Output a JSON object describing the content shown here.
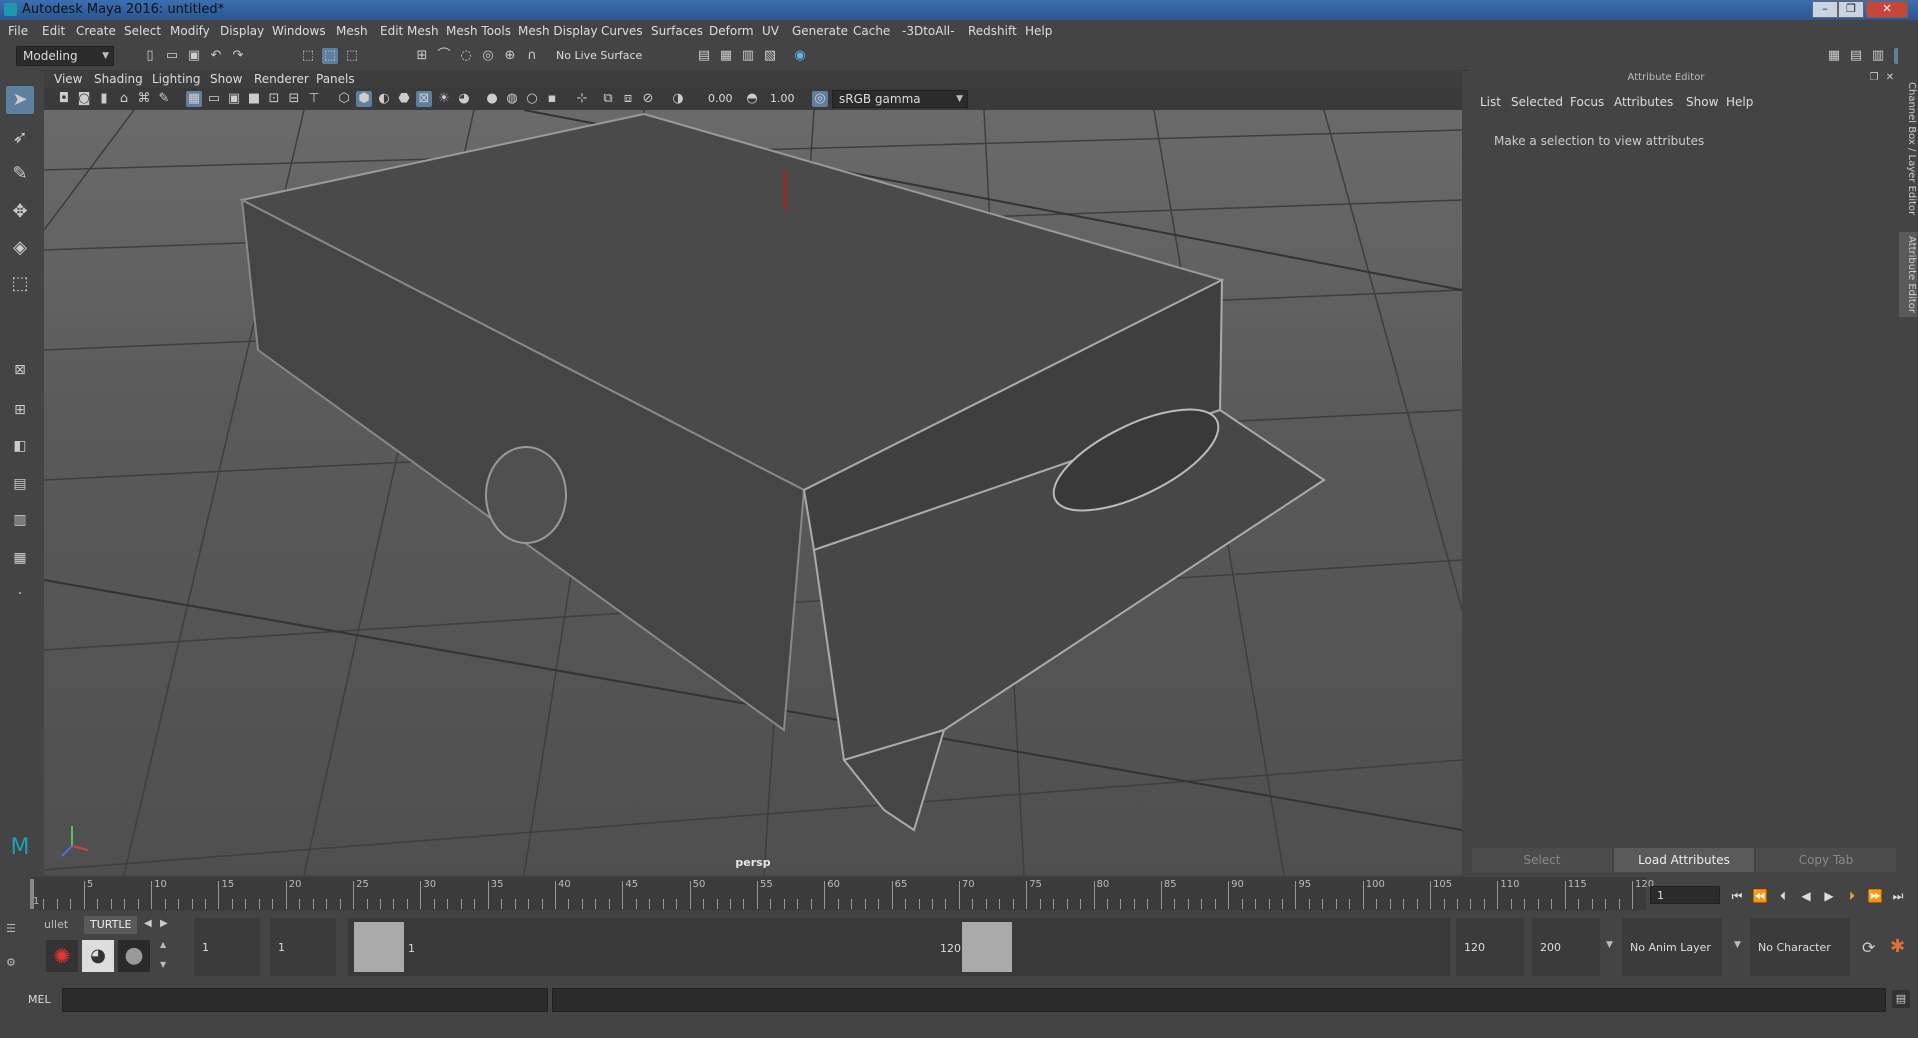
{
  "window": {
    "title": "Autodesk Maya 2016: untitled*"
  },
  "menubar": [
    "File",
    "Edit",
    "Create",
    "Select",
    "Modify",
    "Display",
    "Windows",
    "Mesh",
    "Edit Mesh",
    "Mesh Tools",
    "Mesh Display",
    "Curves",
    "Surfaces",
    "Deform",
    "UV",
    "Generate",
    "Cache",
    "-3DtoAll-",
    "Redshift",
    "Help"
  ],
  "toolbar": {
    "mode": "Modeling",
    "live_surface": "No Live Surface"
  },
  "viewport": {
    "menu": [
      "View",
      "Shading",
      "Lighting",
      "Show",
      "Renderer",
      "Panels"
    ],
    "exposure": "0.00",
    "gamma": "1.00",
    "color_space": "sRGB gamma",
    "camera_label": "persp"
  },
  "attribute_editor": {
    "title": "Attribute Editor",
    "menu": [
      "List",
      "Selected",
      "Focus",
      "Attributes",
      "Show",
      "Help"
    ],
    "message": "Make a selection to view attributes",
    "buttons": {
      "select": "Select",
      "load": "Load Attributes",
      "copy": "Copy Tab"
    }
  },
  "side_tabs": {
    "channel_box": "Channel Box / Layer Editor",
    "attribute_editor": "Attribute Editor"
  },
  "time_slider": {
    "start": 1,
    "end": 120,
    "labels": [
      "1",
      "5",
      "10",
      "15",
      "20",
      "25",
      "30",
      "35",
      "40",
      "45",
      "50",
      "55",
      "60",
      "65",
      "70",
      "75",
      "80",
      "85",
      "90",
      "95",
      "100",
      "105",
      "110",
      "115",
      "120"
    ],
    "current_frame": "1"
  },
  "range": {
    "start_time": "1",
    "playback_start": "1",
    "range_start_label": "1",
    "range_end_label": "120",
    "playback_end": "120",
    "end_time": "200",
    "anim_layer": "No Anim Layer",
    "character_set": "No Character Set"
  },
  "shelf": {
    "tabs": [
      "ullet",
      "TURTLE"
    ]
  },
  "command_line": {
    "label": "MEL"
  },
  "colors": {
    "accent": "#5d7fa0",
    "title_bar": "#2a5592"
  }
}
